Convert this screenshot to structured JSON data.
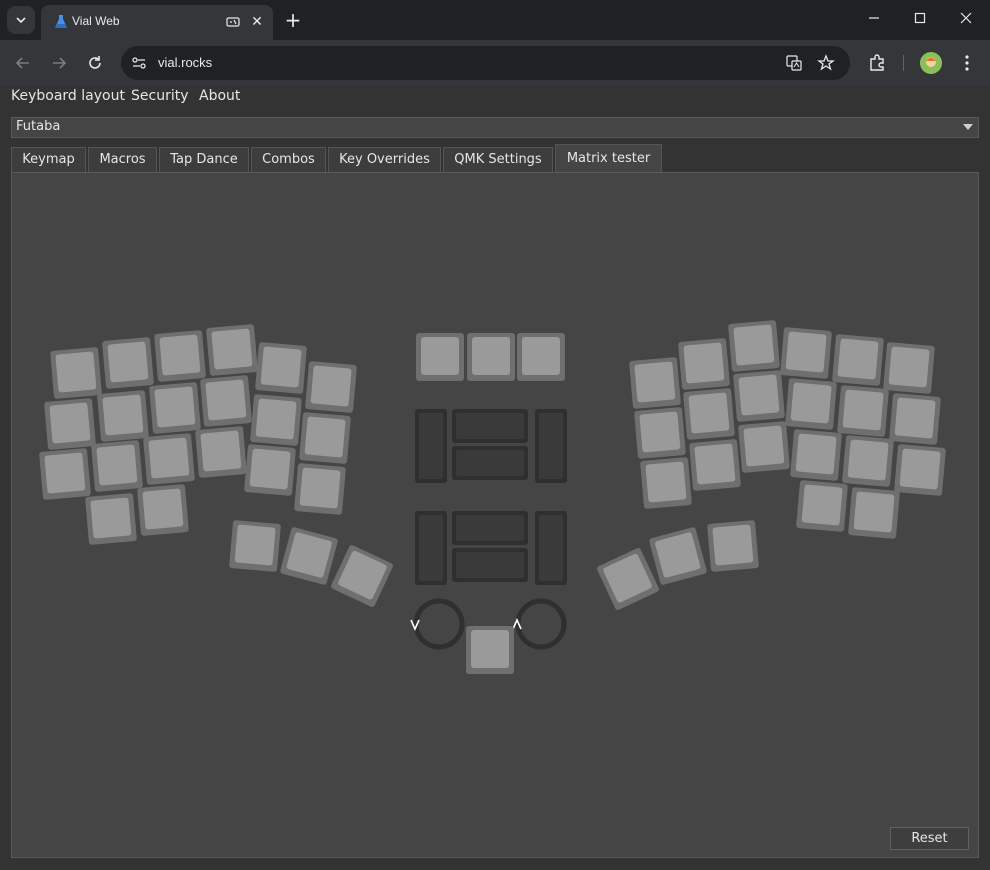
{
  "browser": {
    "tab_title": "Vial Web",
    "url": "vial.rocks"
  },
  "menu": {
    "items": [
      "Keyboard layout",
      "Security",
      "About"
    ]
  },
  "keyboard_select": {
    "value": "Futaba"
  },
  "tabs": [
    "Keymap",
    "Macros",
    "Tap Dance",
    "Combos",
    "Key Overrides",
    "QMK Settings",
    "Matrix tester"
  ],
  "active_tab": "Matrix tester",
  "reset_label": "Reset",
  "colors": {
    "key_fill": "#8a8a8a",
    "key_border": "#6f6f6f",
    "key_top": "#9a9a9a",
    "encoder": "#2f2f2f",
    "panel_bg": "#454545"
  }
}
